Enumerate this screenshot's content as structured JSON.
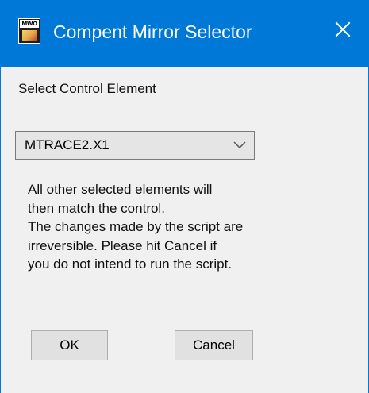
{
  "window": {
    "title": "Compent Mirror Selector",
    "app_icon": "mwo-app-icon",
    "icon_text": "MWO",
    "close_icon": "close-icon"
  },
  "dialog": {
    "control_label": "Select Control Element",
    "selected_control": "MTRACE2.X1",
    "dropdown_icon": "chevron-down-icon",
    "message_lines": [
      "All other selected elements will",
      "then match the control.",
      "The changes made by the script are",
      "irreversible. Please hit Cancel if",
      "you do not intend to run the script."
    ],
    "ok_label": "OK",
    "cancel_label": "Cancel"
  },
  "colors": {
    "title_bar": "#0078d7",
    "title_text": "#ffffff",
    "dialog_background": "#f0f0f0",
    "control_background": "#e1e1e1",
    "control_border": "#adadad"
  }
}
